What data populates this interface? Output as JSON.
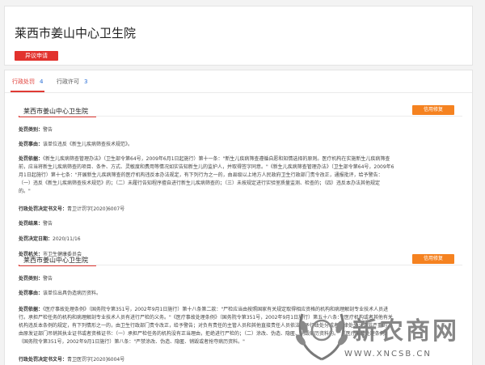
{
  "header": {
    "title": "莱西市姜山中心卫生院",
    "objection_label": "异议申请"
  },
  "tabs": [
    {
      "label": "行政处罚",
      "count": "4"
    },
    {
      "label": "行政许可",
      "count": "3"
    }
  ],
  "labels": {
    "punish_type": "处罚类别：",
    "punish_content": "处罚事由：",
    "punish_basis": "处罚依据：",
    "doc_no": "行政处罚决定书文号：",
    "result": "处罚结果：",
    "decision_date": "处罚决定日期：",
    "authority": "处罚机关："
  },
  "records": [
    {
      "name": "莱西市姜山中心卫生院",
      "repair_label": "信用修复",
      "type": "警告",
      "content": "该单位违反《新生儿疾病筛查技术规范》。",
      "basis_lines": [
        "《新生儿疾病筛查管理办法》（卫生部令第64号，2009年6月1日起施行）第十一条：\"新生儿疾病筛查遵循自愿和知情选择的原则。医疗机构在实施新生儿疾病筛查",
        "前，应当将新生儿疾病筛查的项目、条件、方式、灵敏度和费用等情况如实告知新生儿的监护人，并取得签字同意。\"《新生儿疾病筛查管理办法》（卫生部令第64号，2009年6",
        "月1日起施行）第十七条：\"开展新生儿疾病筛查的医疗机构违反本办法规定，有下列行为之一的，由县级以上地方人民政府卫生行政部门责令改正，通报批评，给予警告：",
        "（一）违反《新生儿疾病筛查技术规范》的；（二）未履行告知程序擅自进行新生儿疾病筛查的；（三）未按规定进行实验室质量监测、检查的；（四）违反本办法其他规定",
        "的。\""
      ],
      "doc_no": "青卫计罚字[2020]6007号",
      "result": "警告",
      "decision_date": "2020/11/16",
      "authority": "市卫生健康委员会"
    },
    {
      "name": "莱西市姜山中心卫生院",
      "repair_label": "信用修复",
      "type": "警告",
      "content": "该单位出具伪造病历资料。",
      "basis_lines": [
        "《医疗事故处理条例》（国务院令第351号，2002年9月1日施行）第十八条第二款：\"尸检应当由按照国家有关规定取得相应资格的机构和病理解剖专业技术人员进",
        "行。承担尸检任务的机构和病理解剖专业技术人员有进行尸检的义务。\"《医疗事故处理条例》（国务院令第351号，2002年9月1日施行）第五十八条：\"医疗机构或者其他有关",
        "机构违反本条例的规定，有下列情形之一的，由卫生行政部门责令改正，给予警告；对负有责任的主管人员和其他直接责任人员依法给予行政处分或者纪律处分；情节严重的，",
        "由原发证部门吊销其执业证书或者资格证书：（一）承担尸检任务的机构没有正当理由，拒绝进行尸检的；（二）涂改、伪造、隐匿、销毁病历资料的。\"《医疗事故处理条例》",
        "（国务院令第351号，2002年9月1日施行）第八条：\"严禁涂改、伪造、隐匿、销毁或者抢夺病历资料。\""
      ],
      "doc_no": "青卫医罚字[2020]6004号"
    }
  ],
  "watermark": {
    "brand": "新农商网",
    "url": "WWW.XNCSB.CN"
  }
}
